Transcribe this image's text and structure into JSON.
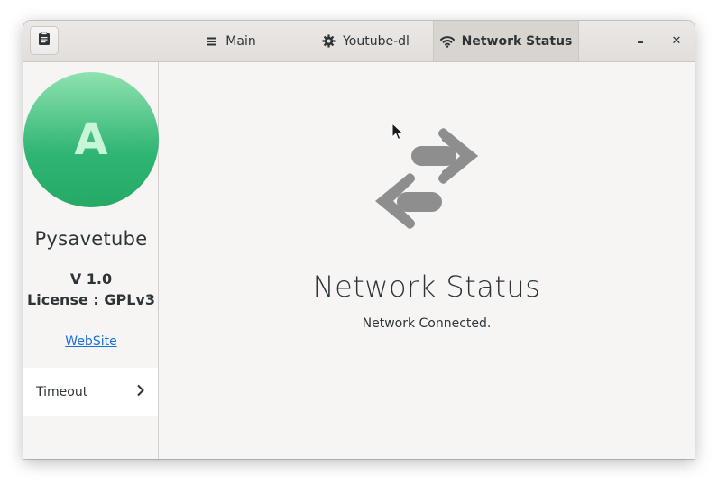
{
  "header": {
    "tabs": [
      {
        "label": "Main",
        "icon": "hamburger-menu-icon",
        "active": false
      },
      {
        "label": "Youtube-dl",
        "icon": "gear-icon",
        "active": false
      },
      {
        "label": "Network Status",
        "icon": "wifi-icon",
        "active": true
      }
    ],
    "minimize_glyph": "–",
    "close_glyph": "✕",
    "clipboard_icon": "clipboard-icon"
  },
  "sidebar": {
    "avatar_initial": "A",
    "app_name": "Pysavetube",
    "version": "V 1.0",
    "license": "License : GPLv3",
    "website_link": "WebSite",
    "row_label": "Timeout",
    "row_icon": "chevron-right-icon"
  },
  "main": {
    "status_icon": "network-transfer-arrows-icon",
    "title": "Network Status",
    "description": "Network Connected."
  },
  "colors": {
    "avatar_top": "#8fe2ae",
    "avatar_bottom": "#26a965",
    "link": "#1c71d8",
    "icon_gray": "#8e8e8e"
  }
}
